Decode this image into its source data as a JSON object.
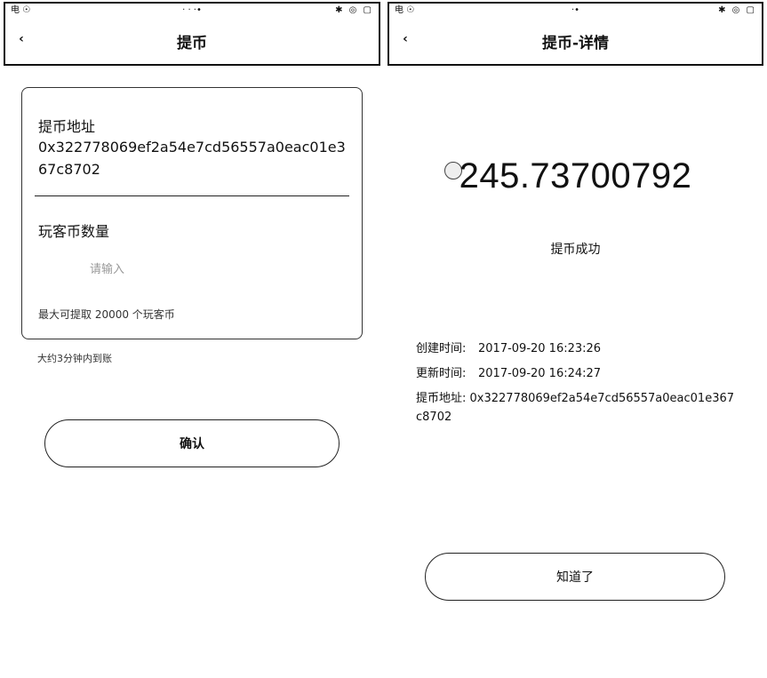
{
  "left": {
    "statusbar": {
      "carrier": "电 ☉",
      "time": "· · ·•",
      "indicators": "✱ ◎ ▢"
    },
    "navbar": {
      "back": "‹",
      "title": "提币"
    },
    "card": {
      "address_label": "提币地址",
      "address_value": "0x322778069ef2a54e7cd56557a0eac01e367c8702",
      "amount_label": "玩客币数量",
      "amount_placeholder": "请输入",
      "max_hint": "最大可提取 20000 个玩客币"
    },
    "time_hint": "大约3分钟内到账",
    "confirm_label": "确认"
  },
  "right": {
    "statusbar": {
      "carrier": "电 ☉",
      "time": "·•",
      "indicators": "✱ ◎ ▢"
    },
    "navbar": {
      "back": "‹",
      "title": "提币-详情"
    },
    "amount": "245.73700792",
    "status_text": "提币成功",
    "details": {
      "created_label": "创建时间:",
      "created_value": "2017-09-20 16:23:26",
      "updated_label": "更新时间:",
      "updated_value": "2017-09-20 16:24:27",
      "address_label": "提币地址:",
      "address_value": "0x322778069ef2a54e7cd56557a0eac01e367c8702"
    },
    "ok_label": "知道了"
  }
}
